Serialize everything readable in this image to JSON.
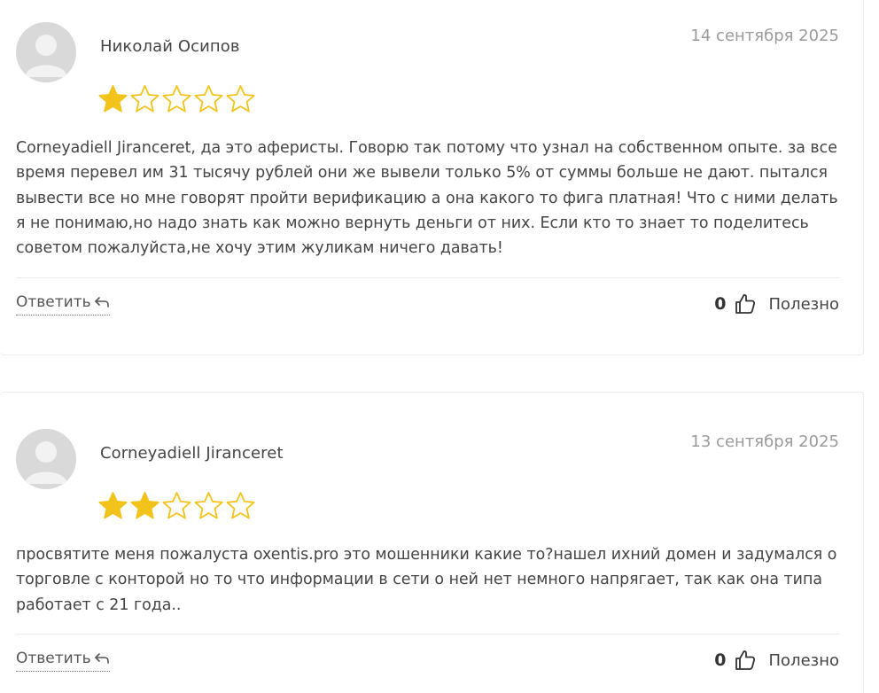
{
  "colors": {
    "star_filled": "#f2c31b",
    "star_empty_stroke": "#f2c31b",
    "avatar_bg": "#d9d9d9",
    "avatar_fg": "#f2f2f2",
    "border": "#ececec",
    "date_text": "#9a9a9a"
  },
  "reviews": [
    {
      "author": "Николай Осипов",
      "date": "14 сентября 2025",
      "rating": 1,
      "rating_max": 5,
      "text": "Corneyadiell Jiranceret, да это аферисты. Говорю так потому что узнал на собственном опыте. за все время перевел им 31 тысячу рублей они же вывели только 5% от суммы больше не дают. пытался вывести все но мне говорят пройти верификацию а она какого то фига платная! Что с ними делать я не понимаю,но надо знать как можно вернуть деньги от них. Если кто то знает то поделитесь советом пожалуйста,не хочу этим жуликам ничего давать!",
      "reply_label": "Ответить",
      "helpful_count": "0",
      "helpful_label": "Полезно"
    },
    {
      "author": "Corneyadiell Jiranceret",
      "date": "13 сентября 2025",
      "rating": 2,
      "rating_max": 5,
      "text": "просвятите меня пожалуста oxentis.pro это мошенники какие то?нашел ихний домен и задумался о торговле с конторой но то что информации в сети о ней нет немного напрягает, так как она типа работает с 21 года..",
      "reply_label": "Ответить",
      "helpful_count": "0",
      "helpful_label": "Полезно"
    }
  ]
}
